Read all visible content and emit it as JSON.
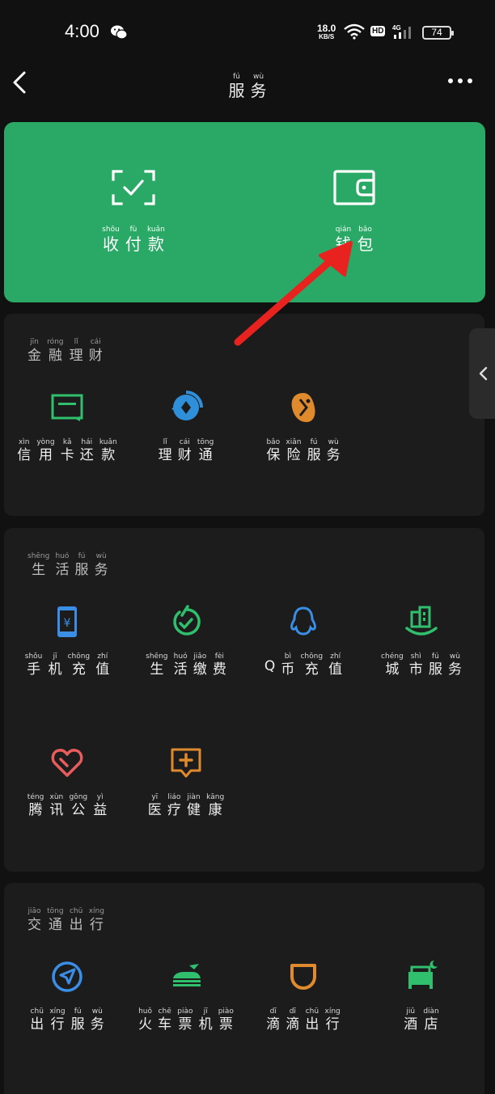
{
  "status_bar": {
    "time": "4:00",
    "speed": "18.0",
    "speed_unit": "KB/S",
    "hd": "HD",
    "network": "4G",
    "battery": "74"
  },
  "header": {
    "title": [
      {
        "py": "fú",
        "hz": "服"
      },
      {
        "py": "wù",
        "hz": "务"
      }
    ]
  },
  "top_actions": [
    {
      "chars": [
        {
          "py": "shōu",
          "hz": "收"
        },
        {
          "py": "fù",
          "hz": "付"
        },
        {
          "py": "kuǎn",
          "hz": "款"
        }
      ],
      "icon": "scan-check-icon"
    },
    {
      "chars": [
        {
          "py": "qián",
          "hz": "钱"
        },
        {
          "py": "bāo",
          "hz": "包"
        }
      ],
      "icon": "wallet-icon"
    }
  ],
  "sections": [
    {
      "title": [
        {
          "py": "jīn",
          "hz": "金"
        },
        {
          "py": "róng",
          "hz": "融"
        },
        {
          "py": "lǐ",
          "hz": "理"
        },
        {
          "py": "cái",
          "hz": "财"
        }
      ],
      "items": [
        {
          "icon": "credit-card-icon",
          "chars": [
            {
              "py": "xìn",
              "hz": "信"
            },
            {
              "py": "yòng",
              "hz": "用"
            },
            {
              "py": "kǎ",
              "hz": "卡"
            },
            {
              "py": "hái",
              "hz": "还"
            },
            {
              "py": "kuǎn",
              "hz": "款"
            }
          ]
        },
        {
          "icon": "wealth-icon",
          "chars": [
            {
              "py": "lǐ",
              "hz": "理"
            },
            {
              "py": "cái",
              "hz": "财"
            },
            {
              "py": "tōng",
              "hz": "通"
            }
          ]
        },
        {
          "icon": "insurance-icon",
          "chars": [
            {
              "py": "bǎo",
              "hz": "保"
            },
            {
              "py": "xiǎn",
              "hz": "险"
            },
            {
              "py": "fú",
              "hz": "服"
            },
            {
              "py": "wù",
              "hz": "务"
            }
          ]
        }
      ]
    },
    {
      "title": [
        {
          "py": "shēng",
          "hz": "生"
        },
        {
          "py": "huó",
          "hz": "活"
        },
        {
          "py": "fú",
          "hz": "服"
        },
        {
          "py": "wù",
          "hz": "务"
        }
      ],
      "items": [
        {
          "icon": "phone-topup-icon",
          "chars": [
            {
              "py": "shǒu",
              "hz": "手"
            },
            {
              "py": "jī",
              "hz": "机"
            },
            {
              "py": "chōng",
              "hz": "充"
            },
            {
              "py": "zhí",
              "hz": "值"
            }
          ]
        },
        {
          "icon": "utility-payment-icon",
          "chars": [
            {
              "py": "shēng",
              "hz": "生"
            },
            {
              "py": "huó",
              "hz": "活"
            },
            {
              "py": "jiǎo",
              "hz": "缴"
            },
            {
              "py": "fèi",
              "hz": "费"
            }
          ]
        },
        {
          "icon": "qq-icon",
          "chars": [
            {
              "py": "",
              "hz": "Q"
            },
            {
              "py": "bì",
              "hz": "币"
            },
            {
              "py": "chōng",
              "hz": "充"
            },
            {
              "py": "zhí",
              "hz": "值"
            }
          ]
        },
        {
          "icon": "city-icon",
          "chars": [
            {
              "py": "chéng",
              "hz": "城"
            },
            {
              "py": "shì",
              "hz": "市"
            },
            {
              "py": "fú",
              "hz": "服"
            },
            {
              "py": "wù",
              "hz": "务"
            }
          ]
        },
        {
          "icon": "charity-heart-icon",
          "chars": [
            {
              "py": "téng",
              "hz": "腾"
            },
            {
              "py": "xùn",
              "hz": "讯"
            },
            {
              "py": "gōng",
              "hz": "公"
            },
            {
              "py": "yì",
              "hz": "益"
            }
          ]
        },
        {
          "icon": "medical-icon",
          "chars": [
            {
              "py": "yī",
              "hz": "医"
            },
            {
              "py": "liáo",
              "hz": "疗"
            },
            {
              "py": "jiàn",
              "hz": "健"
            },
            {
              "py": "kāng",
              "hz": "康"
            }
          ]
        }
      ]
    },
    {
      "title": [
        {
          "py": "jiāo",
          "hz": "交"
        },
        {
          "py": "tōng",
          "hz": "通"
        },
        {
          "py": "chū",
          "hz": "出"
        },
        {
          "py": "xíng",
          "hz": "行"
        }
      ],
      "items": [
        {
          "icon": "navigation-icon",
          "chars": [
            {
              "py": "chū",
              "hz": "出"
            },
            {
              "py": "xíng",
              "hz": "行"
            },
            {
              "py": "fú",
              "hz": "服"
            },
            {
              "py": "wù",
              "hz": "务"
            }
          ]
        },
        {
          "icon": "train-icon",
          "chars": [
            {
              "py": "huǒ",
              "hz": "火"
            },
            {
              "py": "chē",
              "hz": "车"
            },
            {
              "py": "piào",
              "hz": "票"
            },
            {
              "py": "jī",
              "hz": "机"
            },
            {
              "py": "piào",
              "hz": "票"
            }
          ]
        },
        {
          "icon": "didi-icon",
          "chars": [
            {
              "py": "dī",
              "hz": "滴"
            },
            {
              "py": "dī",
              "hz": "滴"
            },
            {
              "py": "chū",
              "hz": "出"
            },
            {
              "py": "xíng",
              "hz": "行"
            }
          ]
        },
        {
          "icon": "hotel-icon",
          "chars": [
            {
              "py": "jiǔ",
              "hz": "酒"
            },
            {
              "py": "diàn",
              "hz": "店"
            }
          ]
        }
      ]
    }
  ]
}
